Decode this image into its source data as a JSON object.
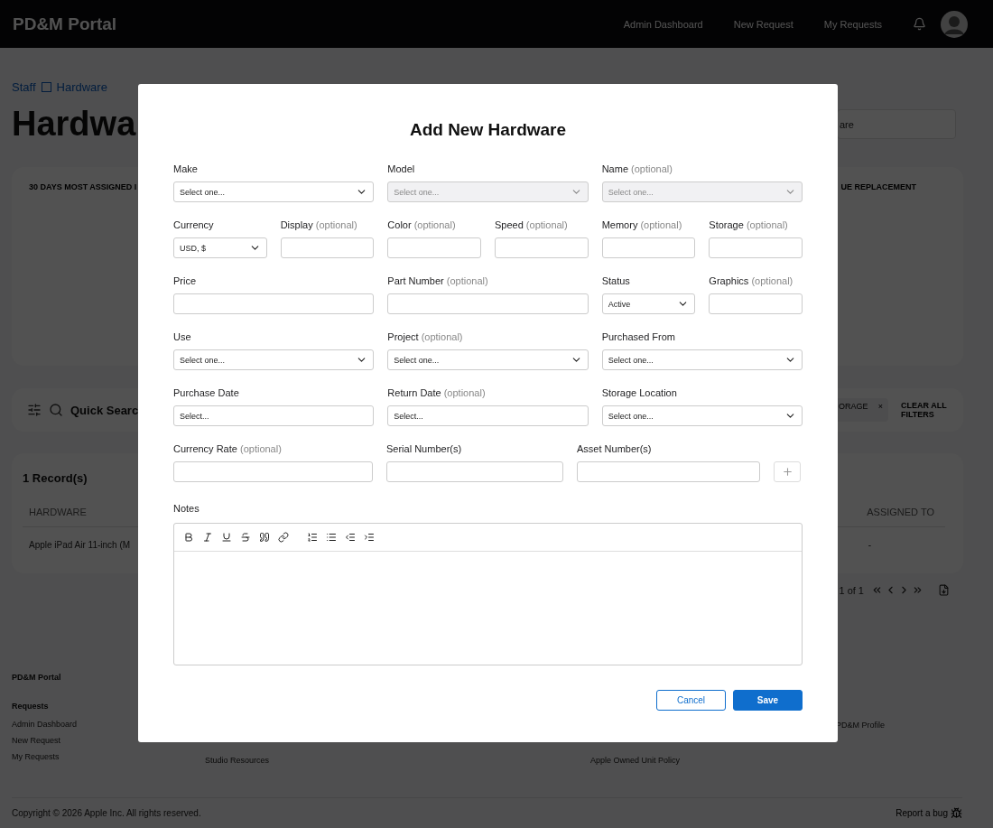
{
  "header": {
    "brand": "PD&M Portal",
    "nav": [
      "Admin Dashboard",
      "New Request",
      "My Requests"
    ]
  },
  "page": {
    "breadcrumb": [
      "Staff",
      "Hardware"
    ],
    "title": "Hardwa",
    "search_value": "are",
    "stats_card": {
      "left_title": "30 DAYS MOST ASSIGNED I",
      "right_title": "UE REPLACEMENT"
    },
    "filter_bar": {
      "search_label": "Quick Searc",
      "chip": "ORAGE",
      "chip_close": "×",
      "clear": "CLEAR ALL FILTERS"
    },
    "records": {
      "count": "1 Record(s)",
      "columns": [
        "HARDWARE",
        "ASSIGNED TO"
      ],
      "row": [
        "Apple iPad Air 11-inch (M",
        "-"
      ]
    },
    "pagination": "1 of 1"
  },
  "footer": {
    "columns": [
      {
        "title": "PD&M Portal",
        "subtitle": "Requests",
        "links": [
          "Admin Dashboard",
          "New Request",
          "My Requests"
        ]
      },
      {
        "links": [
          "Studio Resources"
        ]
      },
      {
        "links": [
          "Apple Owned Unit Policy"
        ]
      },
      {
        "links": [
          "PD&M Profile"
        ]
      }
    ],
    "copyright": "Copyright © 2026 Apple Inc. All rights reserved.",
    "report": "Report a bug"
  },
  "modal": {
    "title": "Add New Hardware",
    "fields": [
      {
        "label": "Make",
        "kind": "select",
        "placeholder": "Select one...",
        "disabled": false
      },
      {
        "label": "Model",
        "kind": "select",
        "placeholder": "Select one...",
        "disabled": true
      },
      {
        "label": "Name",
        "hint": "(optional)",
        "kind": "select",
        "placeholder": "Select one...",
        "disabled": true
      },
      {
        "label": "Currency",
        "kind": "select",
        "value": "USD, $",
        "disabled": false
      },
      {
        "label": "Display",
        "hint": "(optional)",
        "kind": "input",
        "disabled": false
      },
      {
        "label": "Color",
        "hint": "(optional)",
        "kind": "input",
        "disabled": false
      },
      {
        "label": "Speed",
        "hint": "(optional)",
        "kind": "input",
        "disabled": false
      },
      {
        "label": "Memory",
        "hint": "(optional)",
        "kind": "input",
        "disabled": false
      },
      {
        "label": "Storage",
        "hint": "(optional)",
        "kind": "input",
        "disabled": false
      },
      {
        "label": "Price",
        "kind": "input",
        "disabled": false
      },
      {
        "label": "Part Number",
        "hint": "(optional)",
        "kind": "input",
        "disabled": false
      },
      {
        "label": "Status",
        "kind": "select",
        "value": "Active",
        "disabled": false
      },
      {
        "label": "Graphics",
        "hint": "(optional)",
        "kind": "input",
        "disabled": false
      },
      {
        "label": "Use",
        "kind": "select",
        "placeholder": "Select one...",
        "disabled": false
      },
      {
        "label": "Project",
        "hint": "(optional)",
        "kind": "select",
        "placeholder": "Select one...",
        "disabled": false
      },
      {
        "label": "Purchased From",
        "kind": "select",
        "placeholder": "Select one...",
        "disabled": false
      },
      {
        "label": "Purchase Date",
        "kind": "date",
        "placeholder": "Select...",
        "disabled": false
      },
      {
        "label": "Return Date",
        "hint": "(optional)",
        "kind": "date",
        "placeholder": "Select...",
        "disabled": false
      },
      {
        "label": "Storage Location",
        "kind": "select",
        "placeholder": "Select one...",
        "disabled": false
      }
    ],
    "extra_fields": [
      {
        "label": "Currency Rate",
        "hint": "(optional)"
      },
      {
        "label": "Serial Number(s)"
      },
      {
        "label": "Asset Number(s)"
      }
    ],
    "notes_label": "Notes",
    "buttons": [
      {
        "label": "Cancel",
        "kind": "secondary"
      },
      {
        "label": "Save",
        "kind": "primary"
      }
    ]
  }
}
